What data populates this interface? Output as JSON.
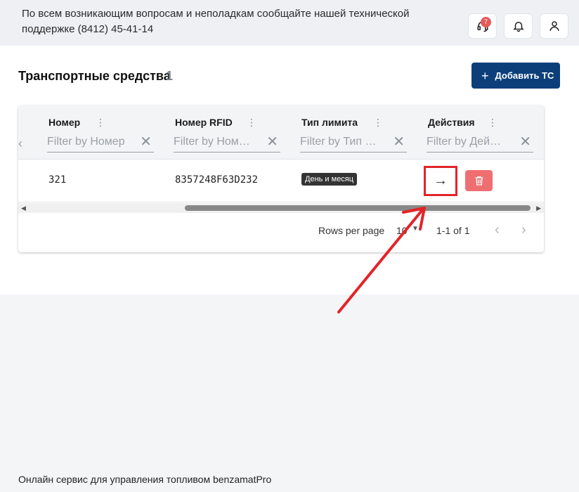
{
  "topbar": {
    "notice": "По всем возникающим вопросам и неполадкам сообщайте нашей технической поддержке (8412) 45-41-14",
    "support_badge": "7",
    "icons": [
      "support-icon",
      "bell-icon",
      "user-icon"
    ]
  },
  "page": {
    "title": "Транспортные средства",
    "count": "1",
    "add_button": "Добавить ТС"
  },
  "grid": {
    "columns": [
      {
        "title": "Номер",
        "filter_placeholder": "Filter by Номер"
      },
      {
        "title": "Номер RFID",
        "filter_placeholder": "Filter by Номер RFID"
      },
      {
        "title": "Тип лимита",
        "filter_placeholder": "Filter by Тип лимита"
      },
      {
        "title": "Действия",
        "filter_placeholder": "Filter by Действия"
      }
    ],
    "rows": [
      {
        "number": "321",
        "rfid": "8357248F63D232",
        "limit_type": "День и месяц"
      }
    ],
    "pagination": {
      "rows_per_page_label": "Rows per page",
      "rows_per_page_value": "10",
      "range": "1-1 of 1"
    }
  },
  "colors": {
    "primary": "#0c3f7a",
    "danger": "#ef6e70",
    "annotation": "#e32428"
  },
  "footer": {
    "text": "Онлайн сервис для управления топливом benzamatPro"
  }
}
